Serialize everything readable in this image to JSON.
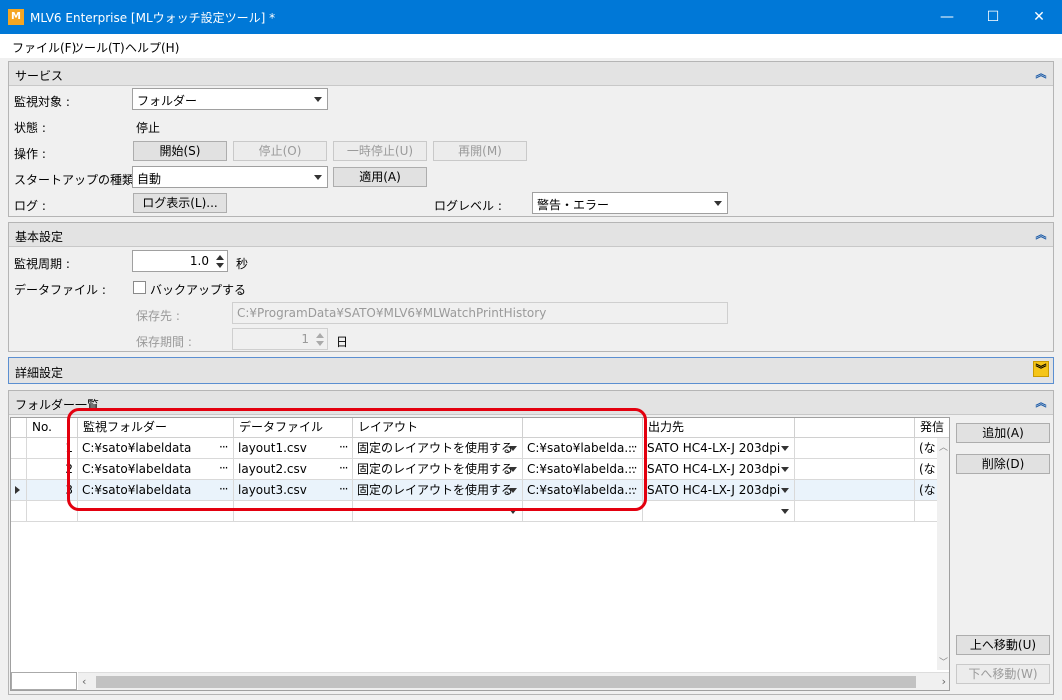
{
  "window": {
    "title": "MLV6 Enterprise [MLウォッチ設定ツール] *",
    "icon_text": "M",
    "minimize": "—",
    "maximize": "☐",
    "close": "✕"
  },
  "menu": {
    "file": "ファイル(F)",
    "tools": "ツール(T)",
    "help": "ヘルプ(H)"
  },
  "service": {
    "title": "サービス",
    "target_label": "監視対象 :",
    "target_value": "フォルダー",
    "status_label": "状態 :",
    "status_value": "停止",
    "operation_label": "操作 :",
    "start": "開始(S)",
    "stop": "停止(O)",
    "pause": "一時停止(U)",
    "resume": "再開(M)",
    "startup_label": "スタートアップの種類 :",
    "startup_value": "自動",
    "apply": "適用(A)",
    "log_label": "ログ :",
    "log_button": "ログ表示(L)...",
    "loglevel_label": "ログレベル :",
    "loglevel_value": "警告・エラー"
  },
  "basic": {
    "title": "基本設定",
    "period_label": "監視周期 :",
    "period_value": "1.0",
    "period_unit": "秒",
    "datafile_label": "データファイル :",
    "backup_label": "バックアップする",
    "dest_label": "保存先 :",
    "dest_value": "C:¥ProgramData¥SATO¥MLV6¥MLWatchPrintHistory",
    "retention_label": "保存期間 :",
    "retention_value": "1",
    "retention_unit": "日"
  },
  "detail": {
    "title": "詳細設定"
  },
  "folders": {
    "title": "フォルダー一覧",
    "columns": {
      "no": "No.",
      "folder": "監視フォルダー",
      "datafile": "データファイル",
      "layout": "レイアウト",
      "output": "出力先",
      "extra": "発信"
    },
    "rows": [
      {
        "no": "1",
        "folder": "C:¥sato¥labeldata",
        "datafile": "layout1.csv",
        "layout": "固定のレイアウトを使用する",
        "layout_path": "C:¥sato¥labelda...",
        "output": "SATO HC4-LX-J 203dpi",
        "extra": "(なし"
      },
      {
        "no": "2",
        "folder": "C:¥sato¥labeldata",
        "datafile": "layout2.csv",
        "layout": "固定のレイアウトを使用する",
        "layout_path": "C:¥sato¥labelda...",
        "output": "SATO HC4-LX-J 203dpi",
        "extra": "(なし"
      },
      {
        "no": "3",
        "folder": "C:¥sato¥labeldata",
        "datafile": "layout3.csv",
        "layout": "固定のレイアウトを使用する",
        "layout_path": "C:¥sato¥labelda...",
        "output": "SATO HC4-LX-J 203dpi",
        "extra": "(なし"
      }
    ],
    "add": "追加(A)",
    "delete": "削除(D)",
    "move_up": "上へ移動(U)",
    "move_down": "下へ移動(W)"
  },
  "colors": {
    "titlebar": "#0078d7",
    "highlight": "#e3000f",
    "selected_row": "#eaf3fb"
  }
}
